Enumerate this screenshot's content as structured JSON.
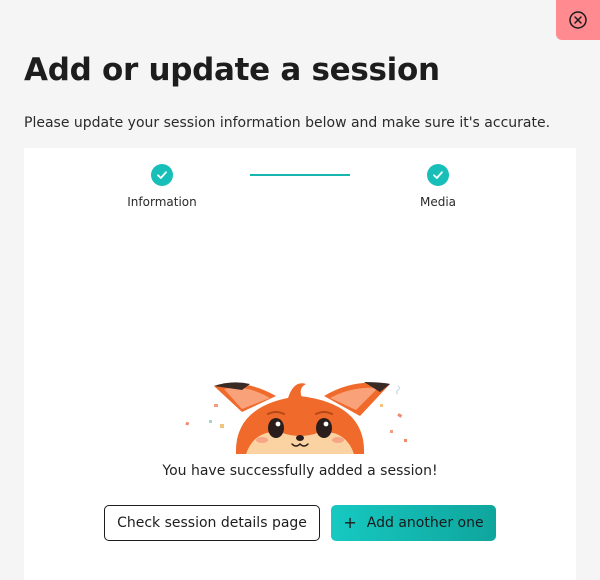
{
  "header": {
    "title": "Add or update a session",
    "subtitle": "Please update your session information below and make sure it's accurate.",
    "close_icon": "close-circle-icon"
  },
  "stepper": {
    "steps": [
      {
        "label": "Information",
        "status": "completed",
        "icon": "check-icon"
      },
      {
        "label": "Media",
        "status": "completed",
        "icon": "check-icon"
      }
    ]
  },
  "success": {
    "illustration": "fox-mascot-confetti",
    "message": "You have successfully added a session!"
  },
  "actions": {
    "details_label": "Check session details page",
    "add_icon": "+",
    "add_label": "Add another one"
  },
  "colors": {
    "accent": "#17bfb8",
    "close_bg": "#ff8a8f",
    "page_bg": "#f5f5f5"
  }
}
